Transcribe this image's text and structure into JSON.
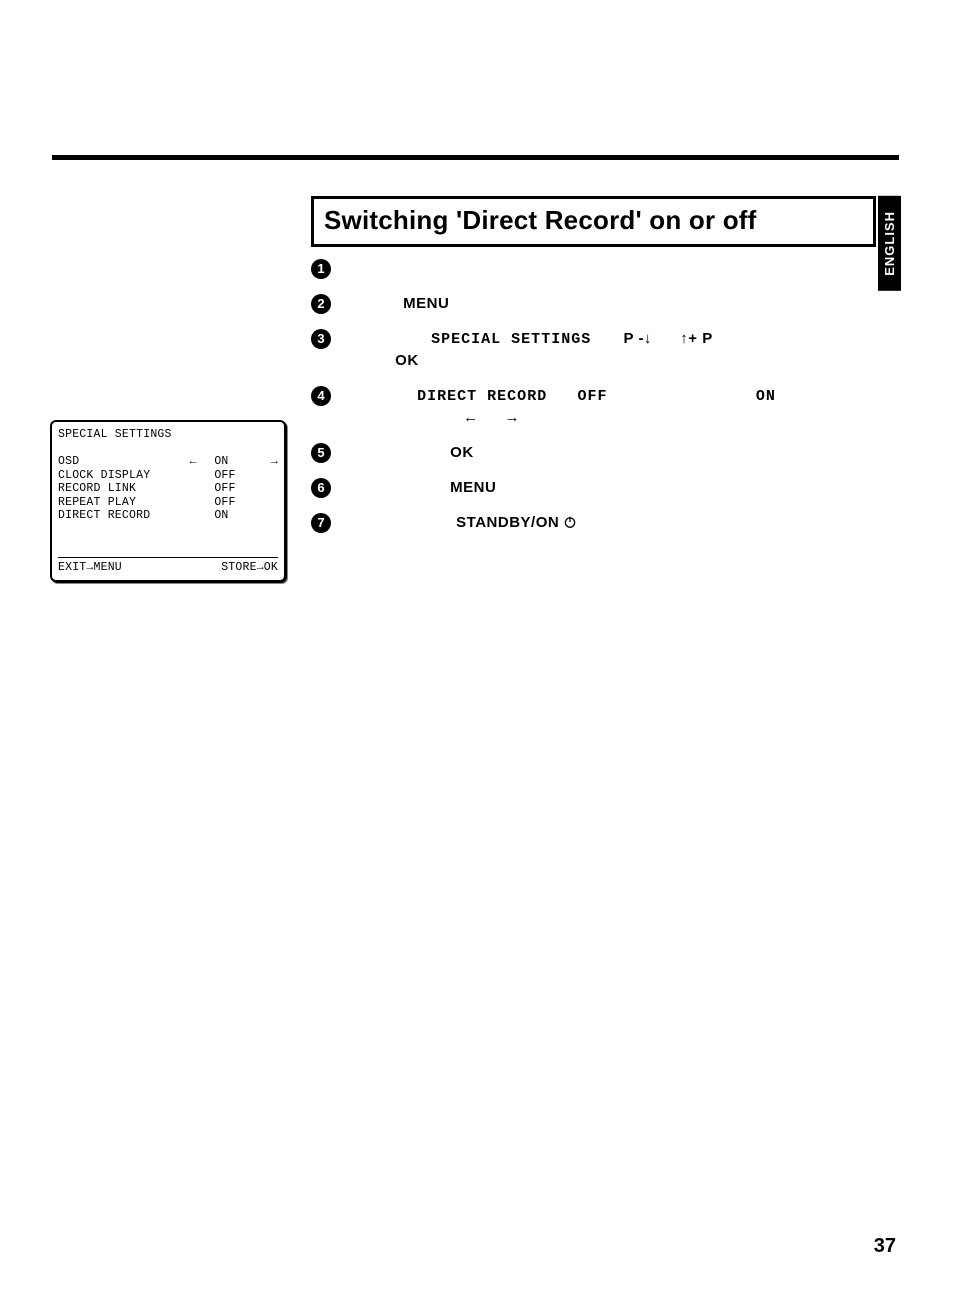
{
  "language_tab": "ENGLISH",
  "section_title": "Switching 'Direct Record' on or off",
  "steps": {
    "s2_menu": "MENU",
    "s3_target": "SPECIAL SETTINGS",
    "s3_p_minus": "P -",
    "s3_p_plus": "+ P",
    "s3_ok": "OK",
    "s4_target": "DIRECT RECORD",
    "s4_off": "OFF",
    "s4_on": "ON",
    "s5_ok": "OK",
    "s6_menu": "MENU",
    "s7_standby": "STANDBY/ON"
  },
  "osd": {
    "title": "SPECIAL SETTINGS",
    "rows": [
      {
        "label": "OSD",
        "value": "ON",
        "selected": true
      },
      {
        "label": "CLOCK DISPLAY",
        "value": "OFF",
        "selected": false
      },
      {
        "label": "RECORD LINK",
        "value": "OFF",
        "selected": false
      },
      {
        "label": "REPEAT PLAY",
        "value": "OFF",
        "selected": false
      },
      {
        "label": "DIRECT RECORD",
        "value": "ON",
        "selected": false
      }
    ],
    "footer_left": "EXIT→MENU",
    "footer_right": "STORE→OK"
  },
  "page_number": "37",
  "bullets": [
    "1",
    "2",
    "3",
    "4",
    "5",
    "6",
    "7"
  ]
}
